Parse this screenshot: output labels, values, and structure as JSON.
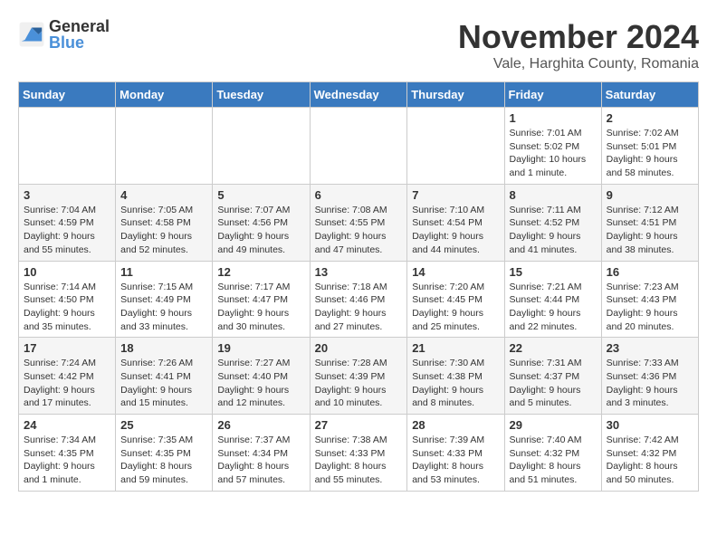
{
  "header": {
    "logo_line1": "General",
    "logo_line2": "Blue",
    "month": "November 2024",
    "location": "Vale, Harghita County, Romania"
  },
  "days_of_week": [
    "Sunday",
    "Monday",
    "Tuesday",
    "Wednesday",
    "Thursday",
    "Friday",
    "Saturday"
  ],
  "weeks": [
    [
      {
        "day": "",
        "info": ""
      },
      {
        "day": "",
        "info": ""
      },
      {
        "day": "",
        "info": ""
      },
      {
        "day": "",
        "info": ""
      },
      {
        "day": "",
        "info": ""
      },
      {
        "day": "1",
        "info": "Sunrise: 7:01 AM\nSunset: 5:02 PM\nDaylight: 10 hours and 1 minute."
      },
      {
        "day": "2",
        "info": "Sunrise: 7:02 AM\nSunset: 5:01 PM\nDaylight: 9 hours and 58 minutes."
      }
    ],
    [
      {
        "day": "3",
        "info": "Sunrise: 7:04 AM\nSunset: 4:59 PM\nDaylight: 9 hours and 55 minutes."
      },
      {
        "day": "4",
        "info": "Sunrise: 7:05 AM\nSunset: 4:58 PM\nDaylight: 9 hours and 52 minutes."
      },
      {
        "day": "5",
        "info": "Sunrise: 7:07 AM\nSunset: 4:56 PM\nDaylight: 9 hours and 49 minutes."
      },
      {
        "day": "6",
        "info": "Sunrise: 7:08 AM\nSunset: 4:55 PM\nDaylight: 9 hours and 47 minutes."
      },
      {
        "day": "7",
        "info": "Sunrise: 7:10 AM\nSunset: 4:54 PM\nDaylight: 9 hours and 44 minutes."
      },
      {
        "day": "8",
        "info": "Sunrise: 7:11 AM\nSunset: 4:52 PM\nDaylight: 9 hours and 41 minutes."
      },
      {
        "day": "9",
        "info": "Sunrise: 7:12 AM\nSunset: 4:51 PM\nDaylight: 9 hours and 38 minutes."
      }
    ],
    [
      {
        "day": "10",
        "info": "Sunrise: 7:14 AM\nSunset: 4:50 PM\nDaylight: 9 hours and 35 minutes."
      },
      {
        "day": "11",
        "info": "Sunrise: 7:15 AM\nSunset: 4:49 PM\nDaylight: 9 hours and 33 minutes."
      },
      {
        "day": "12",
        "info": "Sunrise: 7:17 AM\nSunset: 4:47 PM\nDaylight: 9 hours and 30 minutes."
      },
      {
        "day": "13",
        "info": "Sunrise: 7:18 AM\nSunset: 4:46 PM\nDaylight: 9 hours and 27 minutes."
      },
      {
        "day": "14",
        "info": "Sunrise: 7:20 AM\nSunset: 4:45 PM\nDaylight: 9 hours and 25 minutes."
      },
      {
        "day": "15",
        "info": "Sunrise: 7:21 AM\nSunset: 4:44 PM\nDaylight: 9 hours and 22 minutes."
      },
      {
        "day": "16",
        "info": "Sunrise: 7:23 AM\nSunset: 4:43 PM\nDaylight: 9 hours and 20 minutes."
      }
    ],
    [
      {
        "day": "17",
        "info": "Sunrise: 7:24 AM\nSunset: 4:42 PM\nDaylight: 9 hours and 17 minutes."
      },
      {
        "day": "18",
        "info": "Sunrise: 7:26 AM\nSunset: 4:41 PM\nDaylight: 9 hours and 15 minutes."
      },
      {
        "day": "19",
        "info": "Sunrise: 7:27 AM\nSunset: 4:40 PM\nDaylight: 9 hours and 12 minutes."
      },
      {
        "day": "20",
        "info": "Sunrise: 7:28 AM\nSunset: 4:39 PM\nDaylight: 9 hours and 10 minutes."
      },
      {
        "day": "21",
        "info": "Sunrise: 7:30 AM\nSunset: 4:38 PM\nDaylight: 9 hours and 8 minutes."
      },
      {
        "day": "22",
        "info": "Sunrise: 7:31 AM\nSunset: 4:37 PM\nDaylight: 9 hours and 5 minutes."
      },
      {
        "day": "23",
        "info": "Sunrise: 7:33 AM\nSunset: 4:36 PM\nDaylight: 9 hours and 3 minutes."
      }
    ],
    [
      {
        "day": "24",
        "info": "Sunrise: 7:34 AM\nSunset: 4:35 PM\nDaylight: 9 hours and 1 minute."
      },
      {
        "day": "25",
        "info": "Sunrise: 7:35 AM\nSunset: 4:35 PM\nDaylight: 8 hours and 59 minutes."
      },
      {
        "day": "26",
        "info": "Sunrise: 7:37 AM\nSunset: 4:34 PM\nDaylight: 8 hours and 57 minutes."
      },
      {
        "day": "27",
        "info": "Sunrise: 7:38 AM\nSunset: 4:33 PM\nDaylight: 8 hours and 55 minutes."
      },
      {
        "day": "28",
        "info": "Sunrise: 7:39 AM\nSunset: 4:33 PM\nDaylight: 8 hours and 53 minutes."
      },
      {
        "day": "29",
        "info": "Sunrise: 7:40 AM\nSunset: 4:32 PM\nDaylight: 8 hours and 51 minutes."
      },
      {
        "day": "30",
        "info": "Sunrise: 7:42 AM\nSunset: 4:32 PM\nDaylight: 8 hours and 50 minutes."
      }
    ]
  ]
}
